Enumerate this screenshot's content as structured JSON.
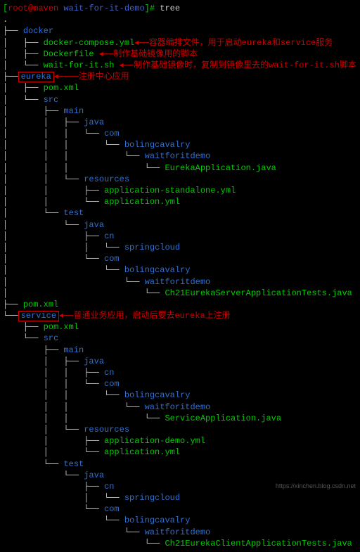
{
  "prompt": {
    "userhost": "root@maven",
    "cwd": "wait-for-it-demo",
    "cmd": "tree"
  },
  "tree": {
    "root": ".",
    "docker": "docker",
    "docker_compose": "docker-compose.yml",
    "dockerfile": "Dockerfile",
    "wait_for_it": "wait-for-it.sh",
    "eureka": "eureka",
    "pom": "pom.xml",
    "src": "src",
    "main": "main",
    "java": "java",
    "com": "com",
    "cn": "cn",
    "bolingcavalry": "bolingcavalry",
    "waitforitdemo": "waitforitdemo",
    "eureka_app": "EurekaApplication.java",
    "resources": "resources",
    "app_standalone": "application-standalone.yml",
    "app_yml": "application.yml",
    "test": "test",
    "springcloud": "springcloud",
    "eureka_tests": "Ch21EurekaServerApplicationTests.java",
    "service": "service",
    "service_app": "ServiceApplication.java",
    "app_demo": "application-demo.yml",
    "client_tests": "Ch21EurekaClientApplicationTests.java"
  },
  "notes": {
    "compose": "容器编排文件，用于启动eureka和service服务",
    "dockerfile": "制作基础镜像用的脚本",
    "wait": "制作基础镜像时，复制到镜像里去的wait-for-it.sh脚本",
    "eureka": "注册中心应用",
    "service": "普通业务应用，启动后要去eureka上注册"
  },
  "watermark": "https://xinchen.blog.csdn.net"
}
